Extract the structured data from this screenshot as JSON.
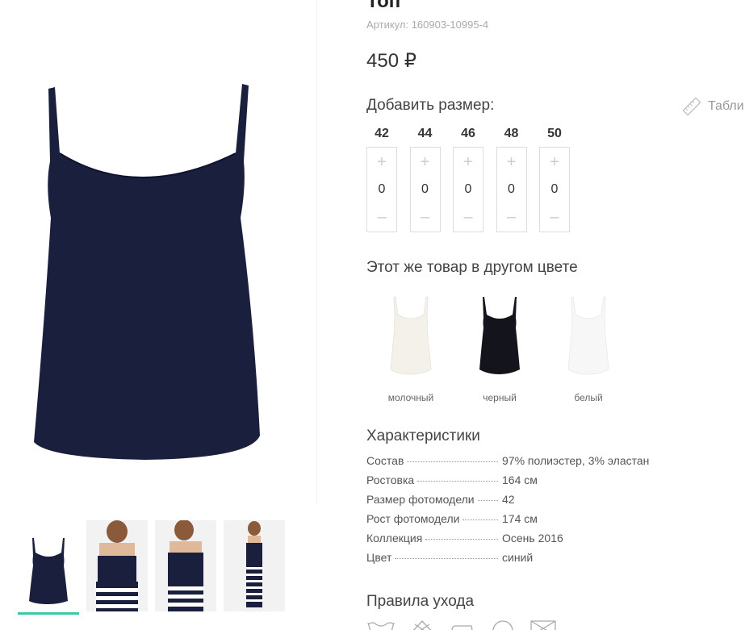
{
  "product": {
    "title": "Топ",
    "sku": "Артикул: 160903-10995-4",
    "price": "450 ₽"
  },
  "sizes": {
    "heading": "Добавить размер:",
    "table_link": "Табли",
    "plus": "+",
    "minus": "–",
    "items": [
      {
        "label": "42",
        "qty": "0"
      },
      {
        "label": "44",
        "qty": "0"
      },
      {
        "label": "46",
        "qty": "0"
      },
      {
        "label": "48",
        "qty": "0"
      },
      {
        "label": "50",
        "qty": "0"
      }
    ]
  },
  "colors": {
    "heading": "Этот же товар в другом цвете",
    "items": [
      {
        "label": "молочный",
        "color": "#f3f1ea"
      },
      {
        "label": "черный",
        "color": "#14151c"
      },
      {
        "label": "белый",
        "color": "#f7f7f7"
      }
    ]
  },
  "characteristics": {
    "heading": "Характеристики",
    "rows": [
      {
        "key": "Состав",
        "value": "97% полиэстер, 3% эластан"
      },
      {
        "key": "Ростовка",
        "value": "164 см"
      },
      {
        "key": "Размер фотомодели",
        "value": "42"
      },
      {
        "key": "Рост фотомодели",
        "value": "174 см"
      },
      {
        "key": "Коллекция",
        "value": "Осень 2016"
      },
      {
        "key": "Цвет",
        "value": "синий"
      }
    ]
  },
  "care": {
    "heading": "Правила ухода"
  },
  "theme": {
    "top_color": "#1a1f3d",
    "accent": "#3cc8a8"
  },
  "icons": [
    "ruler-icon",
    "wash-icon",
    "bleach-icon",
    "iron-icon",
    "dryclean-icon",
    "tumble-dry-icon"
  ]
}
